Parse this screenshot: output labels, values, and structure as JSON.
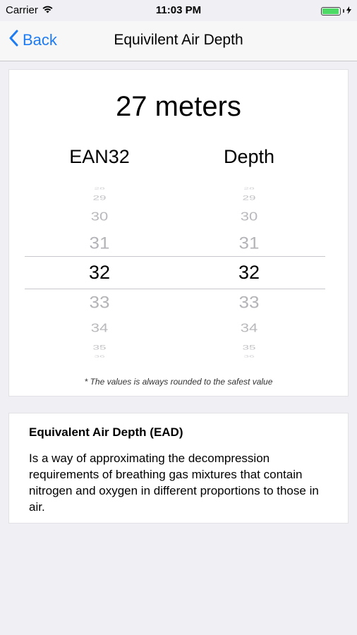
{
  "status_bar": {
    "carrier": "Carrier",
    "time": "11:03 PM",
    "battery_level": 0.95
  },
  "nav": {
    "back_label": "Back",
    "title": "Equivilent Air Depth"
  },
  "calculator": {
    "result": "27 meters",
    "left_column": {
      "header": "EAN32",
      "items": [
        "28",
        "29",
        "30",
        "31",
        "32",
        "33",
        "34",
        "35",
        "36"
      ],
      "selected": "32"
    },
    "right_column": {
      "header": "Depth",
      "items": [
        "28",
        "29",
        "30",
        "31",
        "32",
        "33",
        "34",
        "35",
        "36"
      ],
      "selected": "32"
    },
    "footnote": "* The values is always rounded to the safest value"
  },
  "description": {
    "title": "Equivalent Air Depth (EAD)",
    "text": "Is a way of approximating the decompression requirements of breathing gas mixtures that contain nitrogen and oxygen in different proportions to those in air."
  },
  "colors": {
    "accent": "#1e7cf2",
    "battery": "#4cd964",
    "background": "#efeff4"
  }
}
